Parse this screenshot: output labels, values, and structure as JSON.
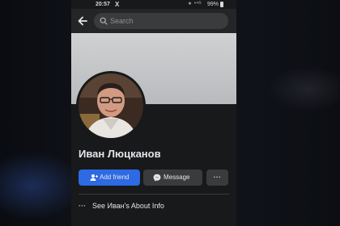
{
  "status_bar": {
    "time": "20:57",
    "x_icon_text": "X",
    "icons_text": "∗ ⁿ⁴ᴳ",
    "battery": "99%"
  },
  "header": {
    "back_icon": "back-arrow-icon",
    "search_placeholder": "Search"
  },
  "profile": {
    "name": "Иван Люцканов",
    "add_friend_label": "Add friend",
    "message_label": "Message",
    "more_label": "···",
    "about_label": "See Иван's About Info",
    "about_icon": "···"
  },
  "colors": {
    "accent": "#2d6ae3",
    "surface": "#242526",
    "background": "#18191a",
    "secondary_button": "#3a3b3c",
    "text": "#e4e6eb"
  }
}
